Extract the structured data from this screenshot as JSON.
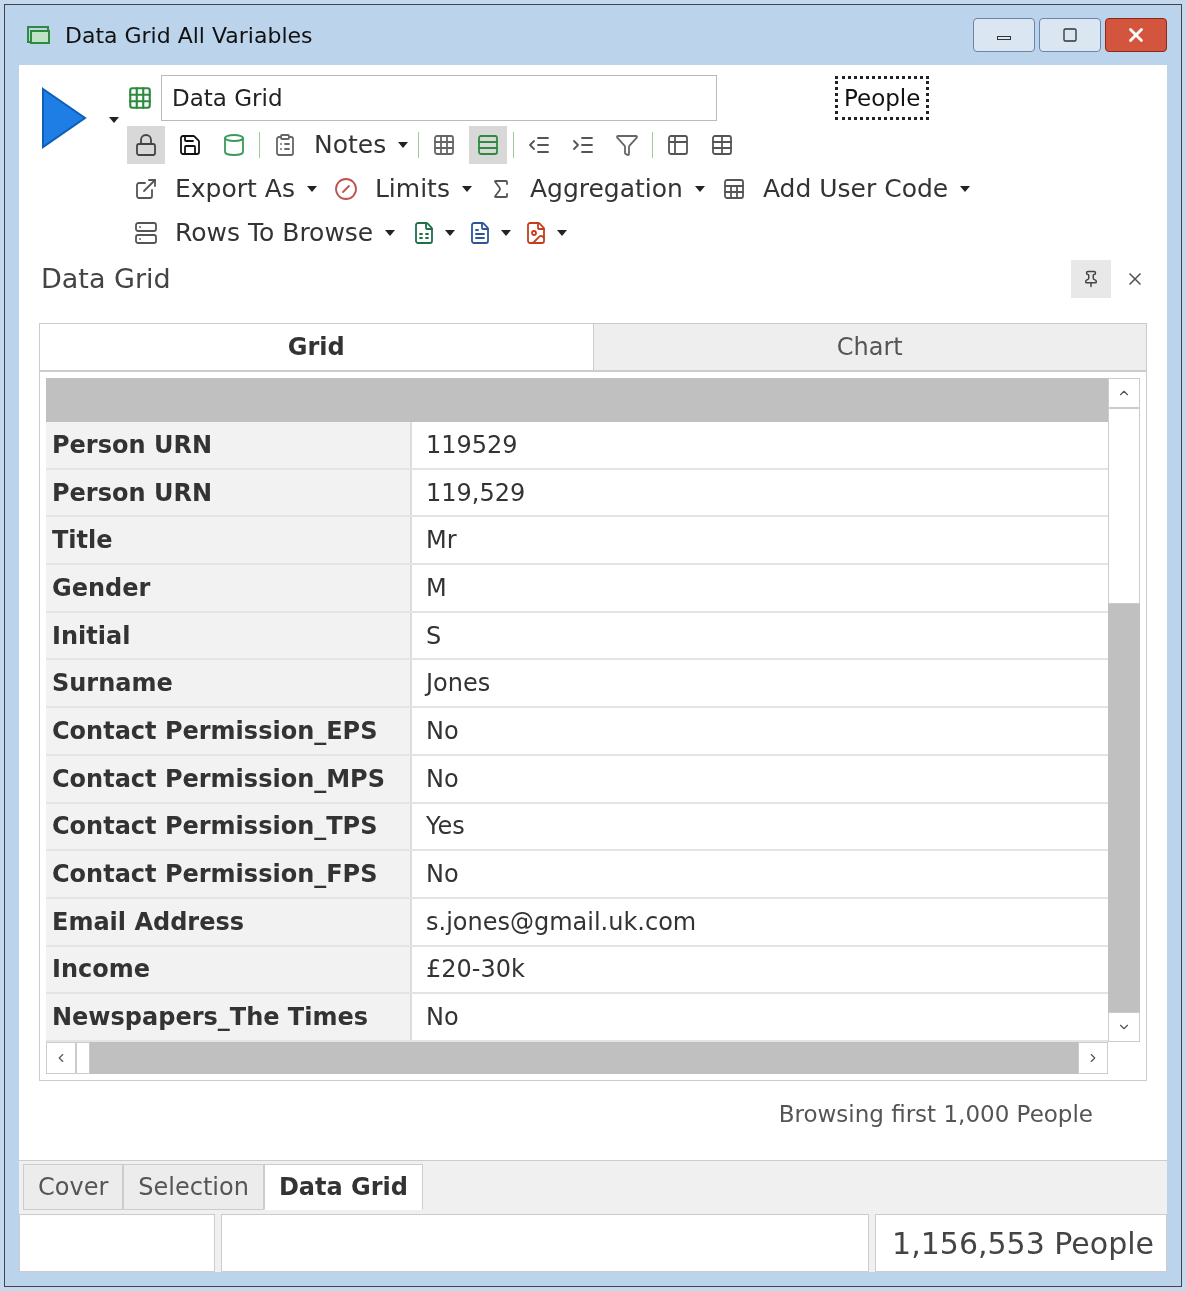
{
  "window": {
    "title": "Data Grid All Variables"
  },
  "header": {
    "name_field": "Data Grid",
    "entity": "People"
  },
  "toolbar_rows": [
    [
      {
        "kind": "icon",
        "pressed": true
      },
      {
        "kind": "icon",
        "pressed": false
      },
      {
        "kind": "icon",
        "pressed": false
      },
      {
        "kind": "sep"
      },
      {
        "kind": "icon",
        "pressed": false
      },
      {
        "kind": "menu",
        "label": "Notes"
      },
      {
        "kind": "sep"
      },
      {
        "kind": "icon",
        "pressed": false
      },
      {
        "kind": "icon",
        "pressed": true
      },
      {
        "kind": "sep"
      },
      {
        "kind": "icon",
        "pressed": false
      },
      {
        "kind": "icon",
        "pressed": false
      },
      {
        "kind": "icon",
        "pressed": false
      },
      {
        "kind": "sep"
      },
      {
        "kind": "icon",
        "pressed": false
      },
      {
        "kind": "icon",
        "pressed": false
      }
    ],
    [
      {
        "kind": "icon",
        "pressed": false
      },
      {
        "kind": "menu",
        "label": "Export As"
      },
      {
        "kind": "icon",
        "pressed": false
      },
      {
        "kind": "menu",
        "label": "Limits"
      },
      {
        "kind": "icon",
        "pressed": false
      },
      {
        "kind": "menu",
        "label": "Aggregation"
      },
      {
        "kind": "icon",
        "pressed": false
      },
      {
        "kind": "menu",
        "label": "Add User Code"
      }
    ],
    [
      {
        "kind": "icon",
        "pressed": false
      },
      {
        "kind": "menu",
        "label": "Rows To Browse"
      },
      {
        "kind": "icon",
        "pressed": false
      },
      {
        "kind": "caret"
      },
      {
        "kind": "icon",
        "pressed": false
      },
      {
        "kind": "caret"
      },
      {
        "kind": "icon",
        "pressed": false
      },
      {
        "kind": "caret"
      }
    ]
  ],
  "panel": {
    "title": "Data Grid"
  },
  "view_tabs": [
    {
      "label": "Grid",
      "selected": true
    },
    {
      "label": "Chart",
      "selected": false
    }
  ],
  "grid_rows": [
    {
      "label": "Person URN",
      "value": "119529"
    },
    {
      "label": "Person URN",
      "value": "119,529"
    },
    {
      "label": "Title",
      "value": "Mr"
    },
    {
      "label": "Gender",
      "value": "M"
    },
    {
      "label": "Initial",
      "value": "S"
    },
    {
      "label": "Surname",
      "value": "Jones"
    },
    {
      "label": "Contact Permission_EPS",
      "value": "No"
    },
    {
      "label": "Contact Permission_MPS",
      "value": "No"
    },
    {
      "label": "Contact Permission_TPS",
      "value": "Yes"
    },
    {
      "label": "Contact Permission_FPS",
      "value": "No"
    },
    {
      "label": "Email Address",
      "value": "s.jones@gmail.uk.com"
    },
    {
      "label": "Income",
      "value": "£20-30k"
    },
    {
      "label": "Newspapers_The Times",
      "value": "No"
    }
  ],
  "browse_note": "Browsing first 1,000 People",
  "bottom_tabs": [
    {
      "label": "Cover",
      "selected": false
    },
    {
      "label": "Selection",
      "selected": false
    },
    {
      "label": "Data Grid",
      "selected": true
    }
  ],
  "status_bar": {
    "count": "1,156,553 People"
  }
}
